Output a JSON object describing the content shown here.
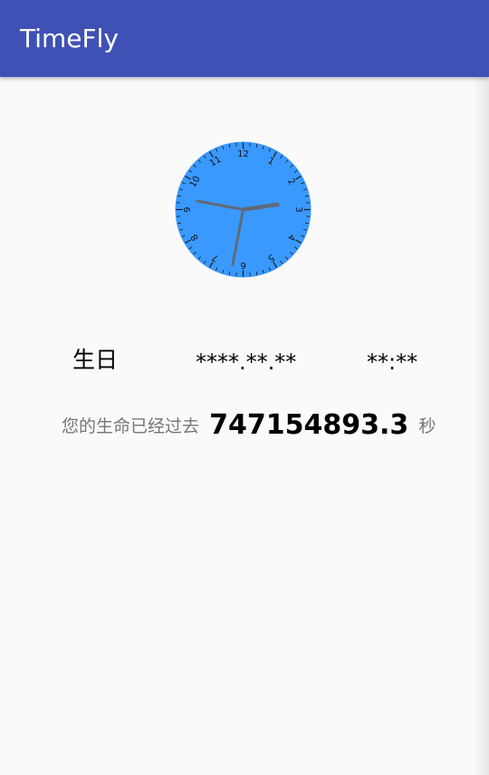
{
  "app": {
    "title": "TimeFly"
  },
  "clock": {
    "face_color": "#3a99ff",
    "hand_color": "#606a7a",
    "numerals": [
      "12",
      "1",
      "2",
      "3",
      "4",
      "5",
      "6",
      "7",
      "8",
      "9",
      "10",
      "11"
    ]
  },
  "birthday": {
    "label": "生日",
    "date": "****.**.**",
    "time": "**:**"
  },
  "elapsed": {
    "prefix": "您的生命已经过去",
    "value": "747154893.3",
    "unit": "秒"
  }
}
